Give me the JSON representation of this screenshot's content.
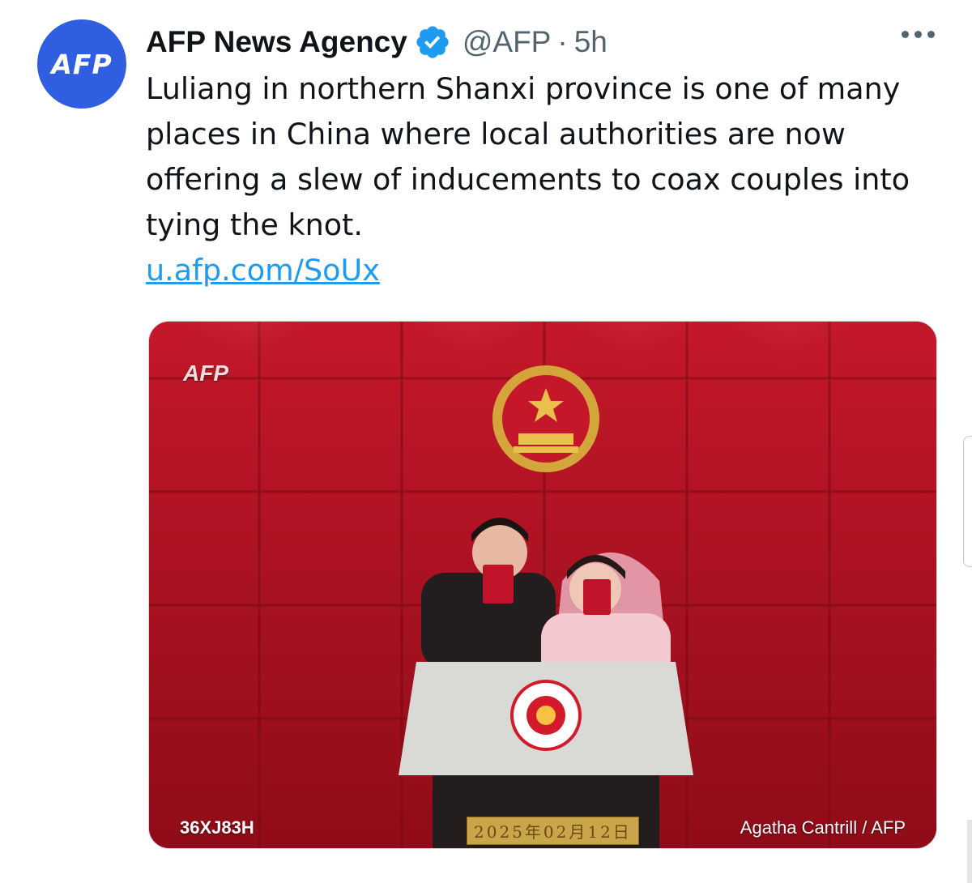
{
  "author": {
    "avatar_text": "AFP",
    "name": "AFP News Agency",
    "handle": "@AFP",
    "separator": "·",
    "time": "5h"
  },
  "tweet": {
    "text": "Luliang in northern Shanxi province is one of many places in China where local authorities are now offering a slew of inducements to coax couples into tying the knot.",
    "link": "u.afp.com/SoUx"
  },
  "media": {
    "watermark": "AFP",
    "photo_id": "36XJ83H",
    "credit": "Agatha Cantrill / AFP",
    "plaque_date": "2025年02月12日"
  },
  "icons": {
    "verified": "verified-badge-icon",
    "more": "more-options-icon"
  },
  "colors": {
    "accent": "#1d9bf0",
    "avatar_bg": "#2f5fe0",
    "wall_red": "#b5121f"
  }
}
